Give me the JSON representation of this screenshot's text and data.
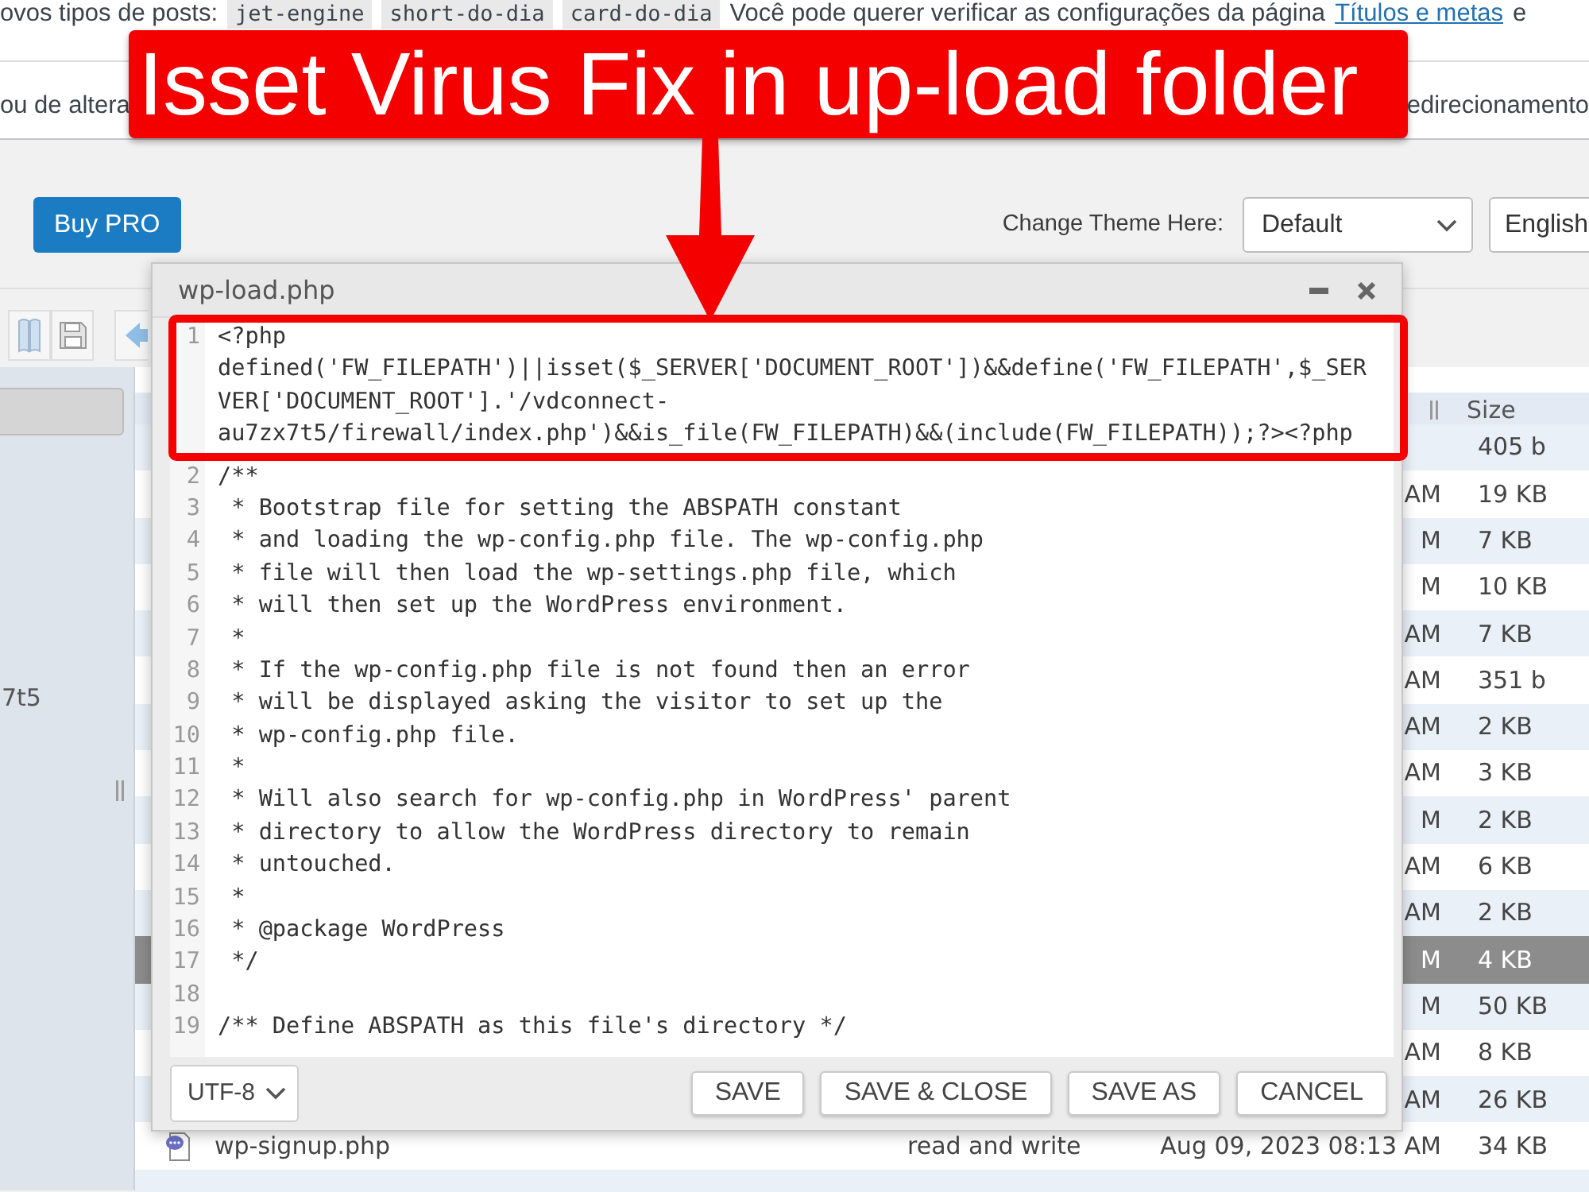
{
  "notices": [
    {
      "segments": [
        {
          "kind": "text",
          "text": "ovos tipos de posts:"
        },
        {
          "kind": "code",
          "text": "jet-engine"
        },
        {
          "kind": "code",
          "text": "short-do-dia"
        },
        {
          "kind": "code",
          "text": "card-do-dia"
        },
        {
          "kind": "text",
          "text": "Você pode querer verificar as configurações da página"
        },
        {
          "kind": "link",
          "text": "Títulos e metas"
        },
        {
          "kind": "text",
          "text": "e"
        }
      ]
    },
    {
      "segments": [
        {
          "kind": "text",
          "text": "ou de altera"
        },
        {
          "kind": "text",
          "text": "edirecionamento"
        }
      ]
    }
  ],
  "annotation": {
    "title": "Isset Virus Fix in up-load folder"
  },
  "toolbar": {
    "buy_button": "Buy PRO",
    "theme_label": "Change Theme Here:",
    "theme_select": "Default",
    "language_select": "English"
  },
  "sidebar": {
    "items": [
      {
        "selected": true
      },
      {
        "label": "7t5",
        "selected": false
      }
    ]
  },
  "file_list": {
    "columns": [
      {
        "label": "Size"
      }
    ],
    "rows": [
      {
        "size": "405 b",
        "selected": false
      },
      {
        "modified": "AM",
        "size": "19 KB",
        "selected": false
      },
      {
        "modified": "M",
        "size": "7 KB",
        "selected": false
      },
      {
        "modified": "M",
        "size": "10 KB",
        "selected": false
      },
      {
        "modified": "AM",
        "size": "7 KB",
        "selected": false
      },
      {
        "modified": "AM",
        "size": "351 b",
        "selected": false
      },
      {
        "modified": "AM",
        "size": "2 KB",
        "selected": false
      },
      {
        "modified": "AM",
        "size": "3 KB",
        "selected": false
      },
      {
        "modified": "M",
        "size": "2 KB",
        "selected": false
      },
      {
        "modified": "AM",
        "size": "6 KB",
        "selected": false
      },
      {
        "modified": "AM",
        "size": "2 KB",
        "selected": false
      },
      {
        "modified": "M",
        "size": "4 KB",
        "selected": true
      },
      {
        "modified": "M",
        "size": "50 KB",
        "selected": false
      },
      {
        "modified": "AM",
        "size": "8 KB",
        "selected": false
      },
      {
        "modified": "AM",
        "size": "26 KB",
        "selected": false
      },
      {
        "name": "wp-signup.php",
        "permissions": "read and write",
        "modified": "Aug 09, 2023 08:13 AM",
        "size": "34 KB",
        "selected": false
      },
      {
        "selected": false
      }
    ]
  },
  "editor": {
    "title": "wp-load.php",
    "lines": [
      {
        "number": "1",
        "text": "<?php",
        "wraps": [
          "defined('FW_FILEPATH')||isset($_SERVER['DOCUMENT_ROOT'])&&define('FW_FILEPATH',$_SER",
          "VER['DOCUMENT_ROOT'].'/vdconnect-",
          "au7zx7t5/firewall/index.php')&&is_file(FW_FILEPATH)&&(include(FW_FILEPATH));?><?php"
        ]
      },
      {
        "number": "2",
        "text": "/**"
      },
      {
        "number": "3",
        "text": " * Bootstrap file for setting the ABSPATH constant"
      },
      {
        "number": "4",
        "text": " * and loading the wp-config.php file. The wp-config.php"
      },
      {
        "number": "5",
        "text": " * file will then load the wp-settings.php file, which"
      },
      {
        "number": "6",
        "text": " * will then set up the WordPress environment."
      },
      {
        "number": "7",
        "text": " *"
      },
      {
        "number": "8",
        "text": " * If the wp-config.php file is not found then an error"
      },
      {
        "number": "9",
        "text": " * will be displayed asking the visitor to set up the"
      },
      {
        "number": "10",
        "text": " * wp-config.php file."
      },
      {
        "number": "11",
        "text": " *"
      },
      {
        "number": "12",
        "text": " * Will also search for wp-config.php in WordPress' parent"
      },
      {
        "number": "13",
        "text": " * directory to allow the WordPress directory to remain"
      },
      {
        "number": "14",
        "text": " * untouched."
      },
      {
        "number": "15",
        "text": " *"
      },
      {
        "number": "16",
        "text": " * @package WordPress"
      },
      {
        "number": "17",
        "text": " */"
      },
      {
        "number": "18"
      },
      {
        "number": "19",
        "text": "/** Define ABSPATH as this file's directory */"
      }
    ],
    "encoding": "UTF-8",
    "buttons": [
      "SAVE",
      "SAVE & CLOSE",
      "SAVE AS",
      "CANCEL"
    ]
  }
}
